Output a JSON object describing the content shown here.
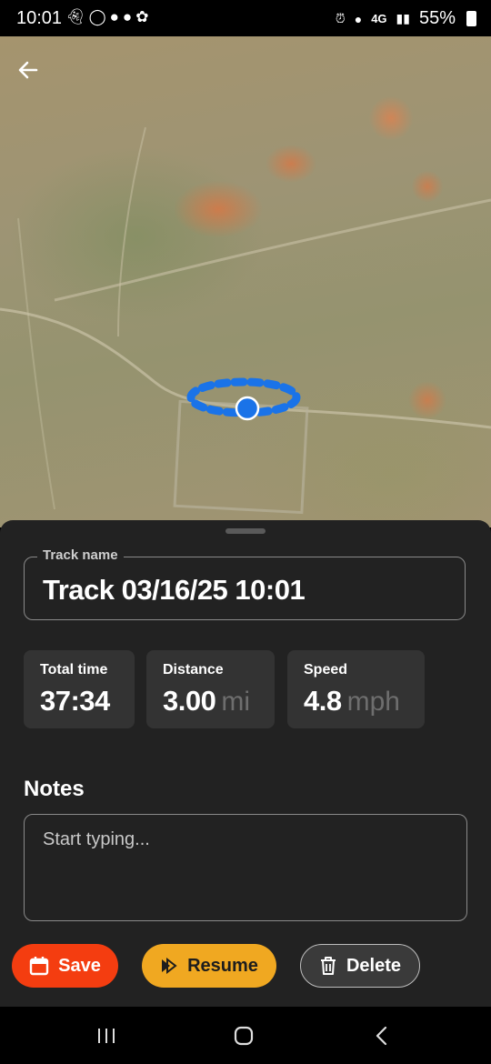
{
  "status_bar": {
    "time": "10:01",
    "left_icons": [
      "snapchat-icon",
      "instagram-icon",
      "messenger-icon",
      "messenger-icon",
      "pinwheel-icon"
    ],
    "network": "4G",
    "battery": "55%"
  },
  "track_name": {
    "label": "Track name",
    "value": "Track 03/16/25 10:01"
  },
  "stats": [
    {
      "label": "Total time",
      "value": "37:34",
      "unit": ""
    },
    {
      "label": "Distance",
      "value": "3.00",
      "unit": "mi"
    },
    {
      "label": "Speed",
      "value": "4.8",
      "unit": "mph"
    }
  ],
  "notes": {
    "title": "Notes",
    "placeholder": "Start typing..."
  },
  "buttons": {
    "save": "Save",
    "resume": "Resume",
    "delete": "Delete"
  },
  "colors": {
    "track_line": "#1a73e8",
    "save": "#f43d10",
    "resume": "#f0a821",
    "sheet": "#222222"
  }
}
